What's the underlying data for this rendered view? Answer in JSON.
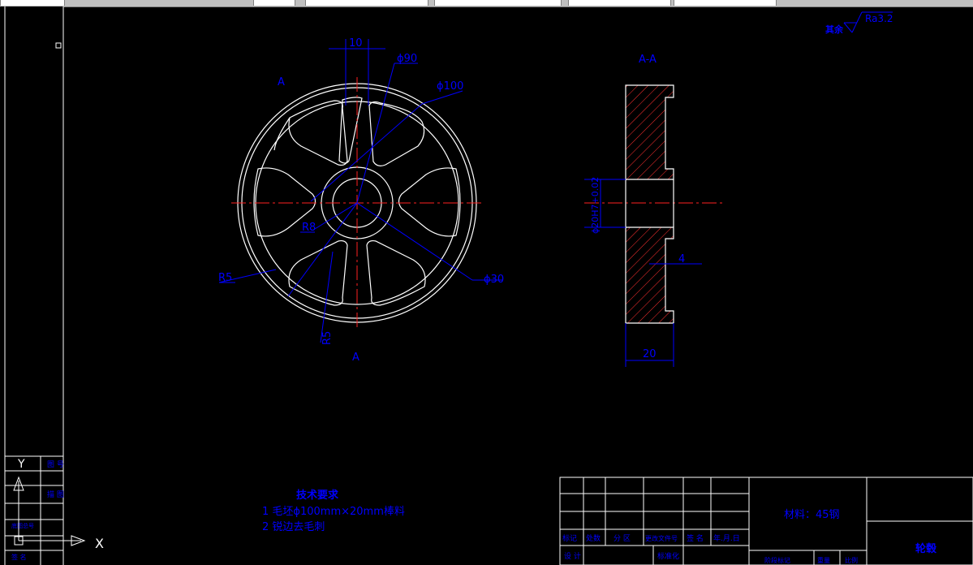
{
  "drawing": {
    "roughness": "Ra3.2",
    "roughness_label": "其余",
    "section_label": "A-A",
    "view_label_top": "A",
    "view_label_bottom": "A",
    "dims": {
      "d10": "10",
      "d90": "ϕ90",
      "d100": "ϕ100",
      "d30": "ϕ30",
      "r8": "R8",
      "r5a": "R5",
      "r5b": "R5",
      "w20": "20",
      "w4": "4",
      "bore": "ϕ20H7+0.02"
    }
  },
  "tech_req": {
    "title": "技术要求",
    "line1": "1  毛坯ϕ100mm×20mm棒料",
    "line2": "2  锐边去毛刺"
  },
  "title_block": {
    "material": "材料：45钢",
    "part_name": "轮毂",
    "headers": [
      "标记",
      "处数",
      "分 区",
      "更改文件号",
      "签 名",
      "年.月.日"
    ],
    "design": "设 计",
    "standard": "标准化",
    "stage": "阶段标记",
    "weight": "重量",
    "scale": "比例"
  },
  "left_strip": {
    "labels": [
      "图 号",
      "描 图",
      "底图总号",
      "签 名"
    ]
  },
  "ucs": {
    "x": "X",
    "y": "Y"
  },
  "colors": {
    "line": "#ffffff",
    "center": "#ff0000",
    "dim": "#0000ff",
    "hatch": "#ff0000"
  }
}
